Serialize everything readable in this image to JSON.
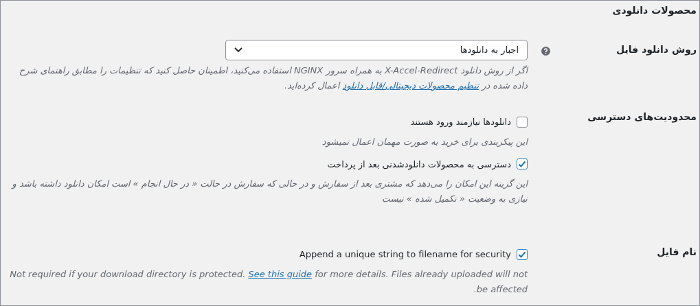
{
  "section_title": "محصولات دانلودی",
  "rows": [
    {
      "label": "روش دانلود فایل",
      "kind": "select",
      "help": true,
      "value": "اجبار به دانلودها",
      "description": {
        "before": "اگر از روش دانلود X-Accel-Redirect به همراه سرور NGINX استفاده می‌کنید، اطمینان حاصل کنید که تنظیمات را مطابق راهنمای شرح داده شده در ",
        "link": "تنظیم محصولات دیجیتالی/قابل دانلود",
        "after": " اعمال کرده‌اید."
      }
    },
    {
      "label": "محدودیت‌های دسترسی",
      "kind": "checkboxes",
      "options": [
        {
          "label": "دانلودها نیازمند ورود هستند",
          "checked": false,
          "description": {
            "before": "این پیکربندی برای خرید به صورت مهمان اعمال نمیشود"
          }
        },
        {
          "label": "دسترسی به محصولات دانلودشدنی بعد از پرداخت",
          "checked": true,
          "description": {
            "before": "این گزینه این امکان را می‌دهد که مشتری بعد از سفارش و در حالی که سفارش در حالت « در حال انجام » است امکان دانلود داشته باشد و نیازی به وضعیت « تکمیل شده » نیست"
          }
        }
      ]
    },
    {
      "label": "نام فایل",
      "kind": "checkboxes",
      "options": [
        {
          "label": "Append a unique string to filename for security",
          "checked": true,
          "description": {
            "before": "Not required if your download directory is protected. ",
            "link": "See this guide",
            "after": " for more details. Files already uploaded will not be affected."
          }
        }
      ]
    }
  ]
}
